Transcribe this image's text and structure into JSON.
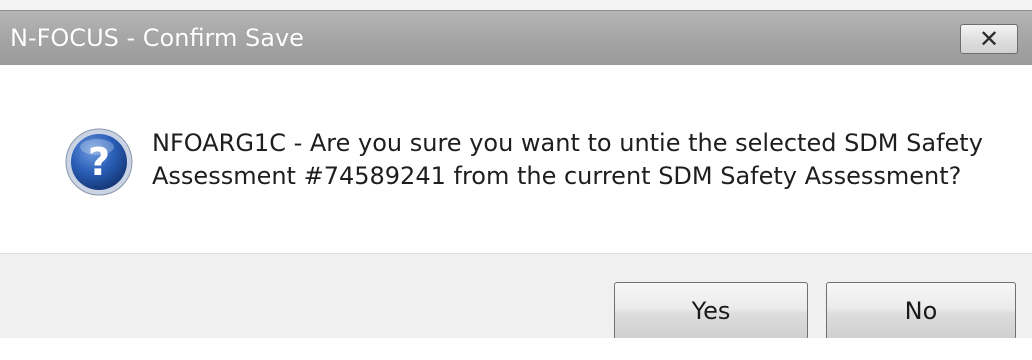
{
  "dialog": {
    "title": "N-FOCUS - Confirm Save",
    "close_symbol": "✕",
    "icon": "question-icon",
    "message": "NFOARG1C - Are you sure you want to untie the selected SDM Safety\nAssessment #74589241 from the current SDM Safety Assessment?",
    "buttons": {
      "yes_label": "Yes",
      "no_label": "No"
    }
  },
  "colors": {
    "titlebar": "#a6a6a6",
    "footer": "#f0f0f0",
    "icon_blue": "#1f4fa0"
  }
}
